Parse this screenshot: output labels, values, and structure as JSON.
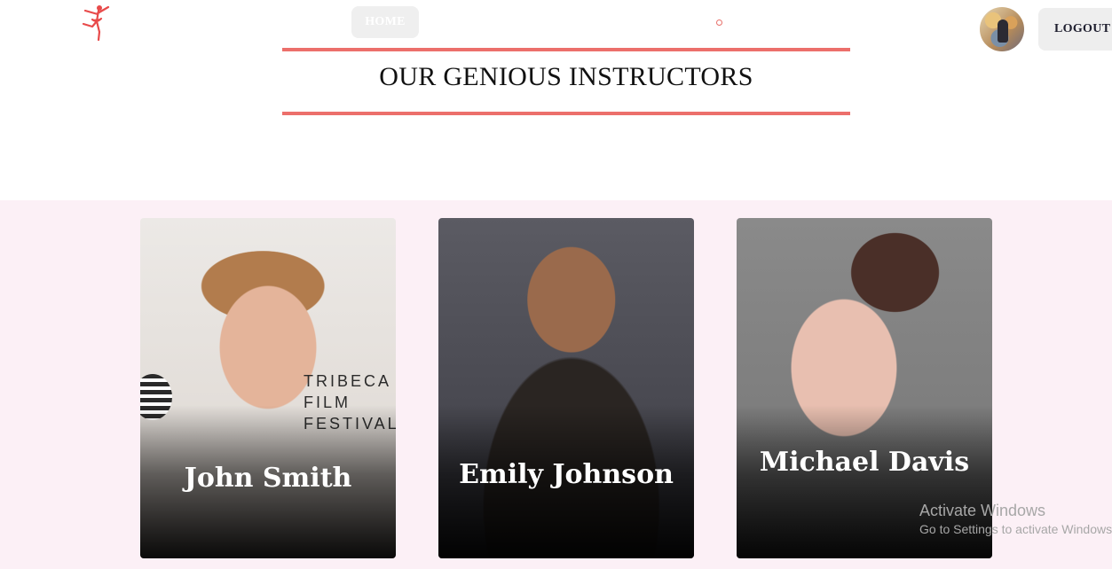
{
  "header": {
    "logo_icon": "ballerina-icon",
    "nav": {
      "home_label": "HOME"
    },
    "avatar_icon": "user-avatar",
    "logout_label": "LOGOUT"
  },
  "page": {
    "title": "OUR GENIOUS INSTRUCTORS"
  },
  "instructors": [
    {
      "name": "John Smith"
    },
    {
      "name": "Emily Johnson"
    },
    {
      "name": "Michael Davis"
    }
  ],
  "photo_text": {
    "card1_sign": "TRIBECA FILM FESTIVAL"
  },
  "watermark": {
    "line1": "Activate Windows",
    "line2": "Go to Settings to activate Windows."
  },
  "colors": {
    "accent": "#ec6f6b",
    "section_bg": "#fcf0f6"
  }
}
